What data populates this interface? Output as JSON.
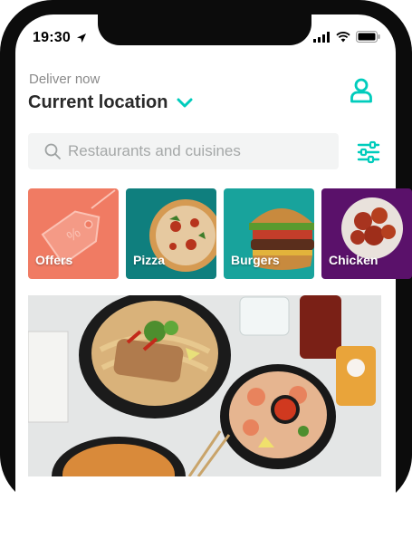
{
  "status_bar": {
    "time": "19:30",
    "icons": [
      "location-arrow-icon",
      "signal-icon",
      "wifi-icon",
      "battery-icon"
    ]
  },
  "header": {
    "deliver_label": "Deliver now",
    "location": "Current location",
    "location_chevron_icon": "chevron-down-icon",
    "profile_icon": "person-icon"
  },
  "search": {
    "placeholder": "Restaurants and cuisines",
    "icon": "search-icon",
    "filter_icon": "sliders-icon"
  },
  "categories": [
    {
      "label": "Offers",
      "color": "#f07b63"
    },
    {
      "label": "Pizza",
      "color": "#0f7f7e"
    },
    {
      "label": "Burgers",
      "color": "#18a39c"
    },
    {
      "label": "Chicken",
      "color": "#5a116a"
    }
  ],
  "colors": {
    "accent": "#00ccbc",
    "frame": "#0c0c0c",
    "search_bg": "#f3f4f4"
  }
}
